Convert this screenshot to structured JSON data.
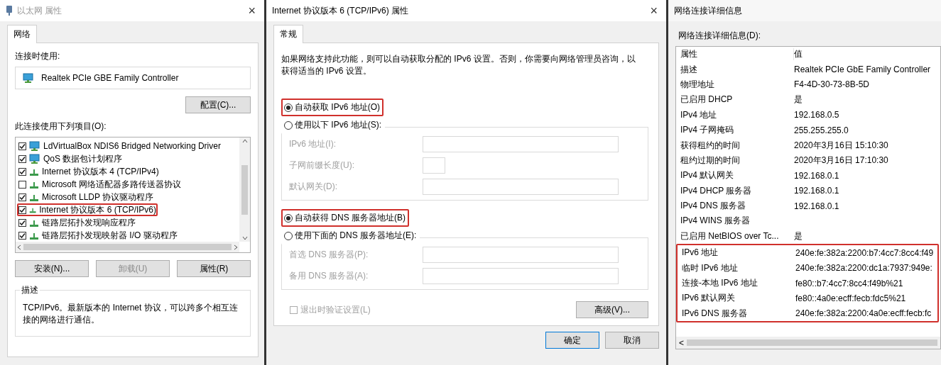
{
  "left_window": {
    "title": "以太网 属性",
    "close": "×",
    "tabs": [
      {
        "label": "网络",
        "selected": true
      }
    ],
    "connect_using_label": "连接时使用:",
    "adapter": "Realtek PCIe GBE Family Controller",
    "configure_button": "配置(C)...",
    "items_label": "此连接使用下列项目(O):",
    "items": [
      {
        "kind": "adapter",
        "label": "LdVirtualBox NDIS6 Bridged Networking Driver",
        "checked": true,
        "highlighted": false
      },
      {
        "kind": "adapter",
        "label": "QoS 数据包计划程序",
        "checked": true,
        "highlighted": false
      },
      {
        "kind": "protocol",
        "label": "Internet 协议版本 4 (TCP/IPv4)",
        "checked": true,
        "highlighted": false
      },
      {
        "kind": "protocol",
        "label": "Microsoft 网络适配器多路传送器协议",
        "checked": false,
        "highlighted": false
      },
      {
        "kind": "protocol",
        "label": "Microsoft LLDP 协议驱动程序",
        "checked": true,
        "highlighted": false
      },
      {
        "kind": "protocol",
        "label": "Internet 协议版本 6 (TCP/IPv6)",
        "checked": true,
        "highlighted": true
      },
      {
        "kind": "protocol",
        "label": "链路层拓扑发现响应程序",
        "checked": true,
        "highlighted": false
      },
      {
        "kind": "protocol",
        "label": "链路层拓扑发现映射器 I/O 驱动程序",
        "checked": true,
        "highlighted": false
      }
    ],
    "buttons": [
      {
        "label": "安装(N)...",
        "disabled": false
      },
      {
        "label": "卸载(U)",
        "disabled": true
      },
      {
        "label": "属性(R)",
        "disabled": false
      }
    ],
    "description": {
      "title": "描述",
      "text": "TCP/IPv6。最新版本的 Internet 协议，可以跨多个相互连接的网络进行通信。"
    }
  },
  "middle_window": {
    "title": "Internet 协议版本 6 (TCP/IPv6) 属性",
    "close": "×",
    "tabs": [
      {
        "label": "常规",
        "selected": true
      }
    ],
    "intro": "如果网络支持此功能，则可以自动获取分配的 IPv6 设置。否则，你需要向网络管理员咨询，以获得适当的 IPv6 设置。",
    "sections": [
      {
        "radios": [
          {
            "label": "自动获取 IPv6 地址(O)",
            "selected": true,
            "highlighted": true
          },
          {
            "label": "使用以下 IPv6 地址(S):",
            "selected": false,
            "highlighted": false
          }
        ],
        "fields": [
          {
            "kind": "wide",
            "label": "IPv6 地址(I):",
            "disabled": true
          },
          {
            "kind": "short",
            "label": "子网前缀长度(U):",
            "disabled": true
          },
          {
            "kind": "wide",
            "label": "默认网关(D):",
            "disabled": true
          }
        ]
      },
      {
        "radios": [
          {
            "label": "自动获得 DNS 服务器地址(B)",
            "selected": true,
            "highlighted": true
          },
          {
            "label": "使用下面的 DNS 服务器地址(E):",
            "selected": false,
            "highlighted": false
          }
        ],
        "fields": [
          {
            "kind": "wide",
            "label": "首选 DNS 服务器(P):",
            "disabled": true
          },
          {
            "kind": "wide",
            "label": "备用 DNS 服务器(A):",
            "disabled": true
          }
        ]
      }
    ],
    "validate_checkbox": {
      "label": "退出时验证设置(L)",
      "checked": false,
      "disabled": true
    },
    "advanced_button": "高级(V)...",
    "footer_buttons": [
      {
        "label": "确定",
        "default": true
      },
      {
        "label": "取消",
        "default": false
      }
    ]
  },
  "right_window": {
    "title": "网络连接详细信息",
    "details_label": "网络连接详细信息(D):",
    "columns": [
      "属性",
      "值"
    ],
    "rows": [
      {
        "property": "描述",
        "value": "Realtek PCIe GbE Family Controller",
        "highlighted": false
      },
      {
        "property": "物理地址",
        "value": "F4-4D-30-73-8B-5D",
        "highlighted": false
      },
      {
        "property": "已启用 DHCP",
        "value": "是",
        "highlighted": false
      },
      {
        "property": "IPv4 地址",
        "value": "192.168.0.5",
        "highlighted": false
      },
      {
        "property": "IPv4 子网掩码",
        "value": "255.255.255.0",
        "highlighted": false
      },
      {
        "property": "获得租约的时间",
        "value": "2020年3月16日 15:10:30",
        "highlighted": false
      },
      {
        "property": "租约过期的时间",
        "value": "2020年3月16日 17:10:30",
        "highlighted": false
      },
      {
        "property": "IPv4 默认网关",
        "value": "192.168.0.1",
        "highlighted": false
      },
      {
        "property": "IPv4 DHCP 服务器",
        "value": "192.168.0.1",
        "highlighted": false
      },
      {
        "property": "IPv4 DNS 服务器",
        "value": "192.168.0.1",
        "highlighted": false
      },
      {
        "property": "IPv4 WINS 服务器",
        "highlighted": false
      },
      {
        "property": "已启用 NetBIOS over Tc...",
        "value": "是",
        "highlighted": false
      },
      {
        "property": "IPv6 地址",
        "value": "240e:fe:382a:2200:b7:4cc7:8cc4:f49",
        "highlighted": true
      },
      {
        "property": "临时 IPv6 地址",
        "value": "240e:fe:382a:2200:dc1a:7937:949e:",
        "highlighted": true
      },
      {
        "property": "连接-本地 IPv6 地址",
        "value": "fe80::b7:4cc7:8cc4:f49b%21",
        "highlighted": true
      },
      {
        "property": "IPv6 默认网关",
        "value": "fe80::4a0e:ecff:fecb:fdc5%21",
        "highlighted": true
      },
      {
        "property": "IPv6 DNS 服务器",
        "value": "240e:fe:382a:2200:4a0e:ecff:fecb:fc",
        "highlighted": true
      }
    ],
    "scroll_left": "<"
  }
}
